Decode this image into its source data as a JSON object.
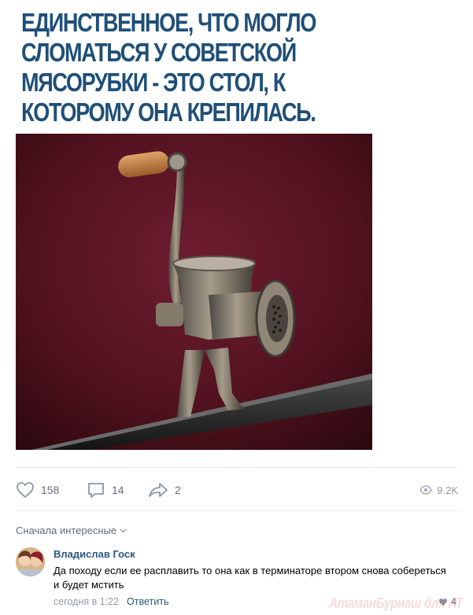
{
  "meme": {
    "caption_lines": [
      "ЕДИНСТВЕННОЕ, ЧТО МОГЛО",
      "СЛОМАТЬСЯ У СОВЕТСКОЙ",
      "МЯСОРУБКИ - ЭТО СТОЛ, К",
      "КОТОРОМУ ОНА КРЕПИЛАСЬ."
    ],
    "caption_color": "#1f4f78",
    "photo_background": "#5a1526"
  },
  "actions": {
    "likes": "158",
    "comments": "14",
    "shares": "2",
    "views": "9.2K"
  },
  "comments_section": {
    "sort_label": "Сначала интересные"
  },
  "comment": {
    "author": "Владислав Госк",
    "text": "Да походу если ее расплавить то она как в терминаторе втором снова собереться и будет мстить",
    "time": "сегодня в 1:22",
    "reply_label": "Ответить",
    "likes": "4"
  },
  "watermark": "АтаманБурнаш для AT",
  "colors": {
    "link": "#2a5885",
    "muted": "#626d7a",
    "border": "#e7e8ec"
  }
}
